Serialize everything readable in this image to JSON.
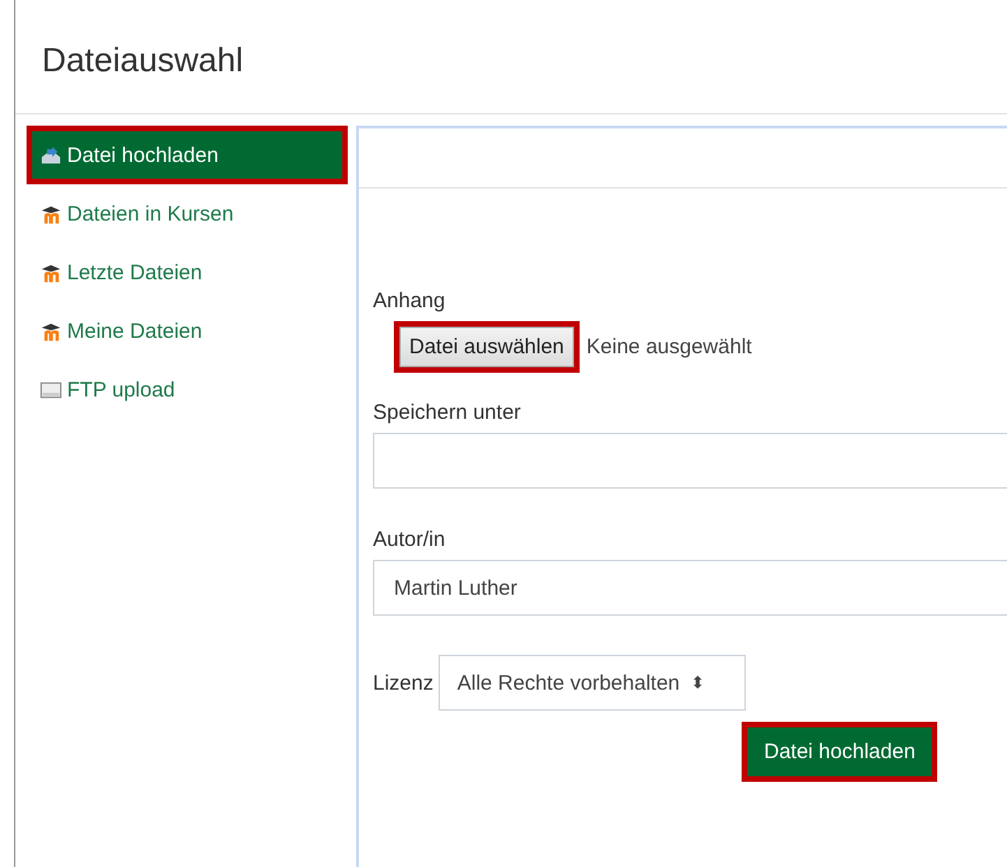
{
  "title": "Dateiauswahl",
  "sidebar": {
    "items": [
      {
        "label": "Datei hochladen",
        "kind": "upload",
        "selected": true,
        "highlighted": true
      },
      {
        "label": "Dateien in Kursen",
        "kind": "course",
        "selected": false,
        "highlighted": false
      },
      {
        "label": "Letzte Dateien",
        "kind": "course",
        "selected": false,
        "highlighted": false
      },
      {
        "label": "Meine Dateien",
        "kind": "course",
        "selected": false,
        "highlighted": false
      },
      {
        "label": "FTP upload",
        "kind": "drive",
        "selected": false,
        "highlighted": false
      }
    ]
  },
  "form": {
    "attachment": {
      "label": "Anhang",
      "button": "Datei auswählen",
      "button_highlighted": true,
      "status": "Keine ausgewählt"
    },
    "save_as": {
      "label": "Speichern unter"
    },
    "author": {
      "label": "Autor/in",
      "value": "Martin Luther"
    },
    "license": {
      "label": "Lizenz",
      "value": "Alle Rechte vorbehalten",
      "arrow": "⬍"
    },
    "submit": {
      "label": "Datei hochladen",
      "highlighted": true
    }
  }
}
